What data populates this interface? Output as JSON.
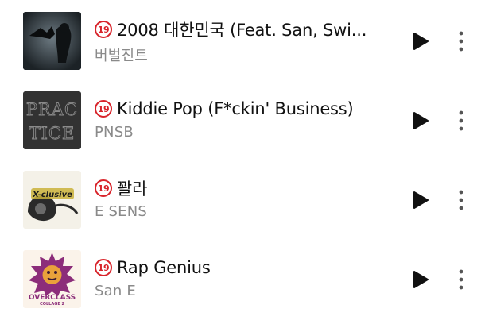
{
  "tracks": [
    {
      "title": "2008 대한민국 (Feat. San, Swi...",
      "artist": "버벌진트",
      "explicit_badge": "19",
      "art_icon": "album-art-dark-bird"
    },
    {
      "title": "Kiddie Pop (F*ckin' Business)",
      "artist": "PNSB",
      "explicit_badge": "19",
      "art_icon": "album-art-practice"
    },
    {
      "title": "꽐라",
      "artist": "E SENS",
      "explicit_badge": "19",
      "art_icon": "album-art-x-clusive"
    },
    {
      "title": "Rap Genius",
      "artist": "San E",
      "explicit_badge": "19",
      "art_icon": "album-art-overclass"
    }
  ],
  "art_text": {
    "practice": [
      "PRAC",
      "TICE"
    ],
    "x_clusive": "X-clusive",
    "overclass": "OVERCLASS",
    "overclass_sub": "COLLAGE 2"
  },
  "colors": {
    "explicit": "#d8232a",
    "title": "#111111",
    "artist": "#8a8a8a",
    "icon": "#111111"
  }
}
